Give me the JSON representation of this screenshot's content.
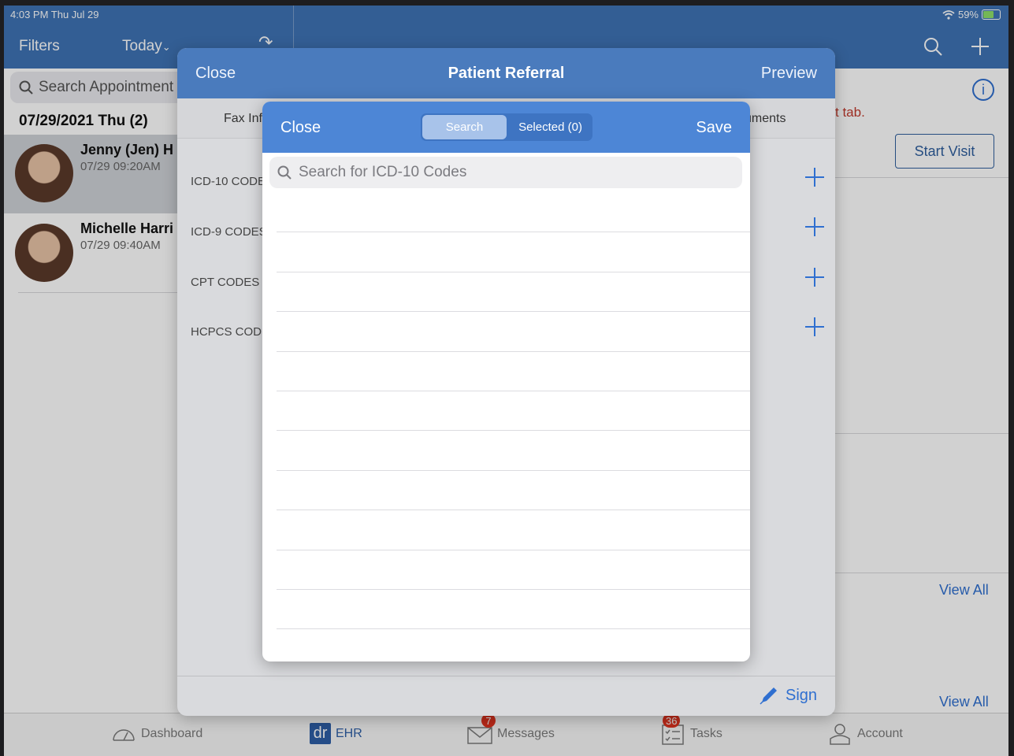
{
  "status_bar": {
    "time": "4:03 PM  Thu Jul 29",
    "battery": "59%"
  },
  "background": {
    "filters": "Filters",
    "today": "Today",
    "search_placeholder": "Search Appointment",
    "date_header": "07/29/2021 Thu (2)",
    "appointments": [
      {
        "name": "Jenny (Jen) H",
        "time": "07/29 09:20AM"
      },
      {
        "name": "Michelle Harri",
        "time": "07/29 09:40AM"
      }
    ],
    "tab_text": "t tab.",
    "start_visit": "Start Visit",
    "view_all_1": "View All",
    "view_all_2": "View All"
  },
  "tab_bar": {
    "items": [
      {
        "label": "Dashboard"
      },
      {
        "label": "EHR",
        "logo": "dr"
      },
      {
        "label": "Messages",
        "badge": "7"
      },
      {
        "label": "Tasks",
        "badge": "36"
      },
      {
        "label": "Account"
      }
    ],
    "active_color": "#2e5fa6"
  },
  "referral": {
    "close": "Close",
    "title": "Patient Referral",
    "preview": "Preview",
    "tab_fax": "Fax Inf",
    "tab_documents": "cuments",
    "rows": [
      {
        "label": "ICD-10 CODE"
      },
      {
        "label": "ICD-9 CODES"
      },
      {
        "label": "CPT CODES"
      },
      {
        "label": "HCPCS CODI"
      }
    ],
    "sign": "Sign"
  },
  "codes_modal": {
    "close": "Close",
    "save": "Save",
    "segments": {
      "search": "Search",
      "selected": "Selected (0)",
      "active": "Search"
    },
    "search_placeholder": "Search for ICD-10 Codes",
    "empty_rows": 12,
    "accent": "#4d86d6"
  }
}
